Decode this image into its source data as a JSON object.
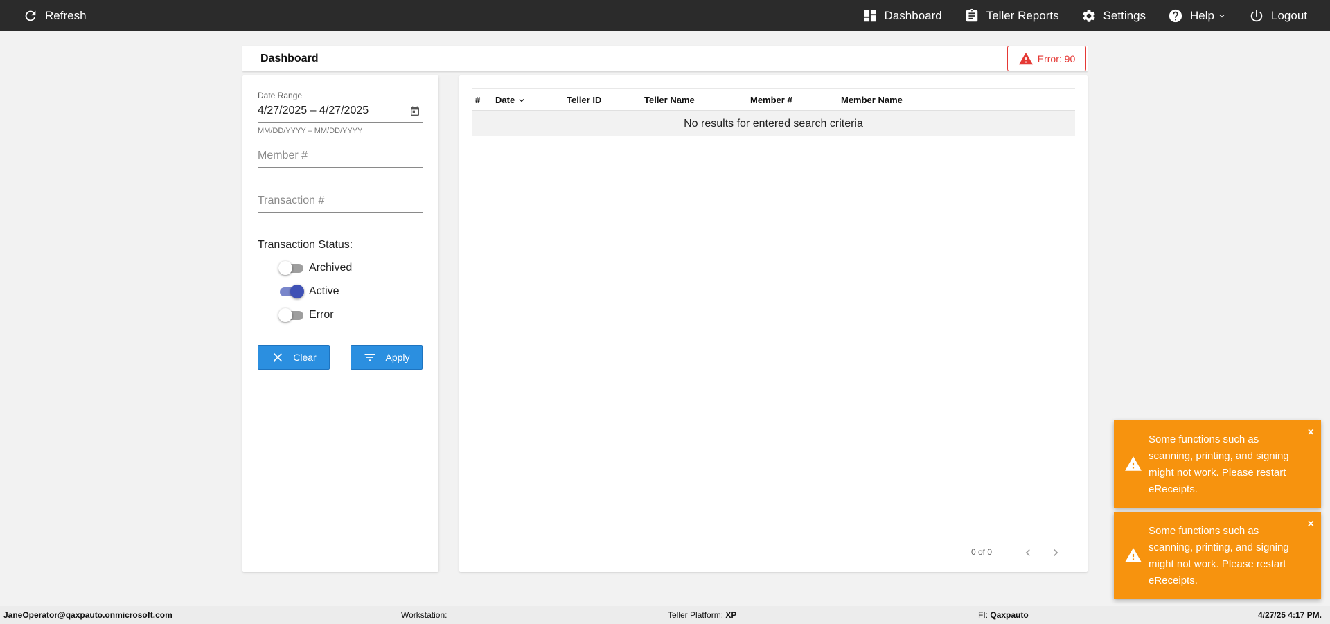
{
  "topbar": {
    "refresh_label": "Refresh",
    "nav": {
      "dashboard": "Dashboard",
      "teller_reports": "Teller Reports",
      "settings": "Settings",
      "help": "Help",
      "logout": "Logout"
    }
  },
  "header": {
    "title": "Dashboard",
    "error_badge": "Error: 90"
  },
  "filters": {
    "date_range_label": "Date Range",
    "date_range_value": "4/27/2025 – 4/27/2025",
    "date_range_hint": "MM/DD/YYYY – MM/DD/YYYY",
    "member_placeholder": "Member #",
    "transaction_placeholder": "Transaction #",
    "status_title": "Transaction Status:",
    "statuses": [
      {
        "label": "Archived",
        "on": false
      },
      {
        "label": "Active",
        "on": true
      },
      {
        "label": "Error",
        "on": false
      }
    ],
    "clear_label": "Clear",
    "apply_label": "Apply"
  },
  "table": {
    "columns": [
      "#",
      "Date",
      "Teller ID",
      "Teller Name",
      "Member #",
      "Member Name"
    ],
    "empty_message": "No results for entered search criteria",
    "pager_text": "0 of 0"
  },
  "toasts": [
    {
      "message": "Some functions such as scanning, printing, and signing might not work. Please restart eReceipts.",
      "close": "×"
    },
    {
      "message": "Some functions such as scanning, printing, and signing might not work. Please restart eReceipts.",
      "close": "×"
    }
  ],
  "footer": {
    "user": "JaneOperator@qaxpauto.onmicrosoft.com",
    "workstation_label": "Workstation:",
    "workstation_value": "",
    "teller_platform_label": "Teller Platform:",
    "teller_platform_value": "XP",
    "fi_label": "FI:",
    "fi_value": "Qaxpauto",
    "datetime": "4/27/25 4:17 PM."
  },
  "colors": {
    "topbar": "#2b2b2b",
    "primary_button": "#2b8fe0",
    "error": "#e53935",
    "toggle_on": "#3f51b5",
    "toast": "#f7930e"
  }
}
